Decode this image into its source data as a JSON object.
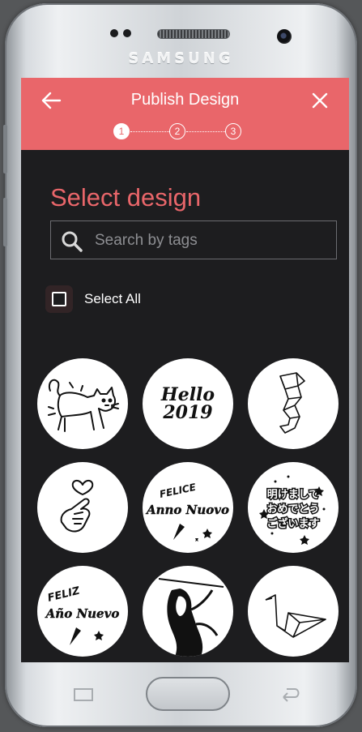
{
  "device": {
    "brand": "SAMSUNG"
  },
  "appbar": {
    "title": "Publish Design",
    "back_icon": "arrow-left-icon",
    "close_icon": "close-icon",
    "steps": [
      "1",
      "2",
      "3"
    ],
    "active_step": 1,
    "color": "#e9666a"
  },
  "main": {
    "heading": "Select design",
    "search": {
      "placeholder": "Search by tags",
      "value": ""
    },
    "select_all_label": "Select All",
    "select_all_checked": false
  },
  "designs": [
    {
      "name": "angry-cat"
    },
    {
      "name": "hello-2019",
      "text_line1": "Hello",
      "text_line2": "2019"
    },
    {
      "name": "origami-seahorse"
    },
    {
      "name": "finger-heart"
    },
    {
      "name": "felice-anno-nuovo",
      "text_line1": "FELICE",
      "text_line2": "Anno Nuovo"
    },
    {
      "name": "akemashite-omedetou",
      "text_line1": "明けまして",
      "text_line2": "おめでとう",
      "text_line3": "ございます"
    },
    {
      "name": "feliz-ano-nuevo",
      "text_line1": "FELIZ",
      "text_line2": "Año Nuevo"
    },
    {
      "name": "samurai-woman"
    },
    {
      "name": "origami-crane"
    }
  ],
  "navigation": {
    "recent_icon": "recent-apps-icon",
    "home_icon": "home-button",
    "back_icon": "back-nav-icon"
  }
}
